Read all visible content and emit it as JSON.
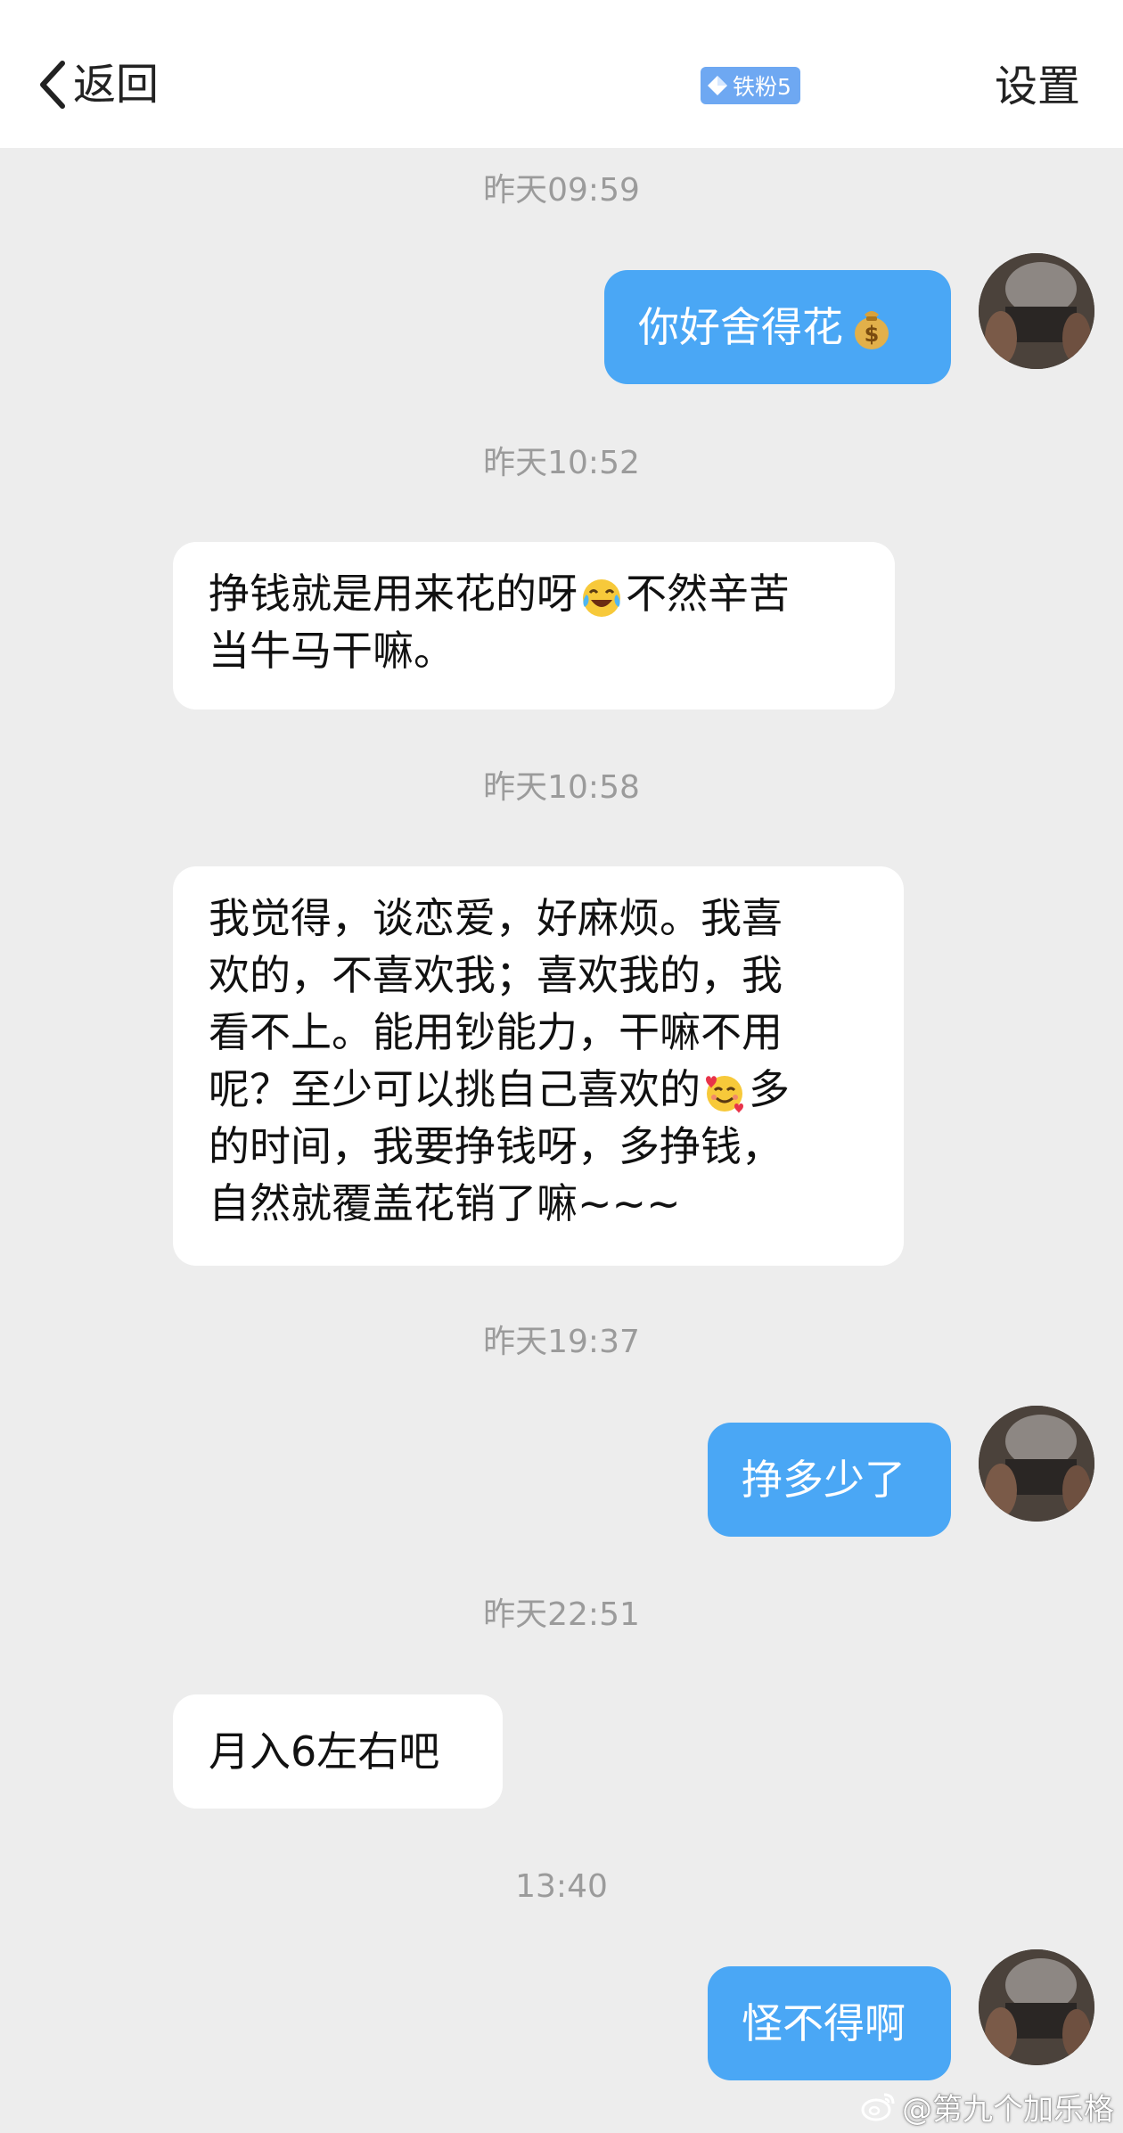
{
  "header": {
    "back_label": "返回",
    "badge_label": "铁粉5",
    "settings_label": "设置",
    "badge_color": "#6ea8f2"
  },
  "messages": [
    {
      "timestamp": "昨天09:59",
      "direction": "outgoing",
      "text": "你好舍得花",
      "emoji": "money-bag-emoji"
    },
    {
      "timestamp": "昨天10:52",
      "direction": "incoming",
      "lines": [
        "挣钱就是用来花的呀",
        "不然辛苦",
        "当牛马干嘛。"
      ],
      "emoji": "tears-of-joy-emoji"
    },
    {
      "timestamp": "昨天10:58",
      "direction": "incoming",
      "lines": [
        "我觉得，谈恋爱，好麻烦。我喜",
        "欢的，不喜欢我；喜欢我的，我",
        "看不上。能用钞能力，干嘛不用",
        "呢？至少可以挑自己喜欢的",
        "多",
        "的时间，我要挣钱呀，多挣钱，",
        "自然就覆盖花销了嘛~~~"
      ],
      "emoji": "smiling-face-with-hearts-emoji"
    },
    {
      "timestamp": "昨天19:37",
      "direction": "outgoing",
      "text": "挣多少了"
    },
    {
      "timestamp": "昨天22:51",
      "direction": "incoming",
      "lines": [
        "月入6左右吧"
      ]
    },
    {
      "timestamp": "13:40",
      "direction": "outgoing",
      "text": "怪不得啊"
    }
  ],
  "watermark": "@第九个加乐格",
  "colors": {
    "outgoing_bubble": "#4aa7f5",
    "incoming_bubble": "#ffffff",
    "background": "#ededed",
    "timestamp": "#9b9b9b"
  }
}
